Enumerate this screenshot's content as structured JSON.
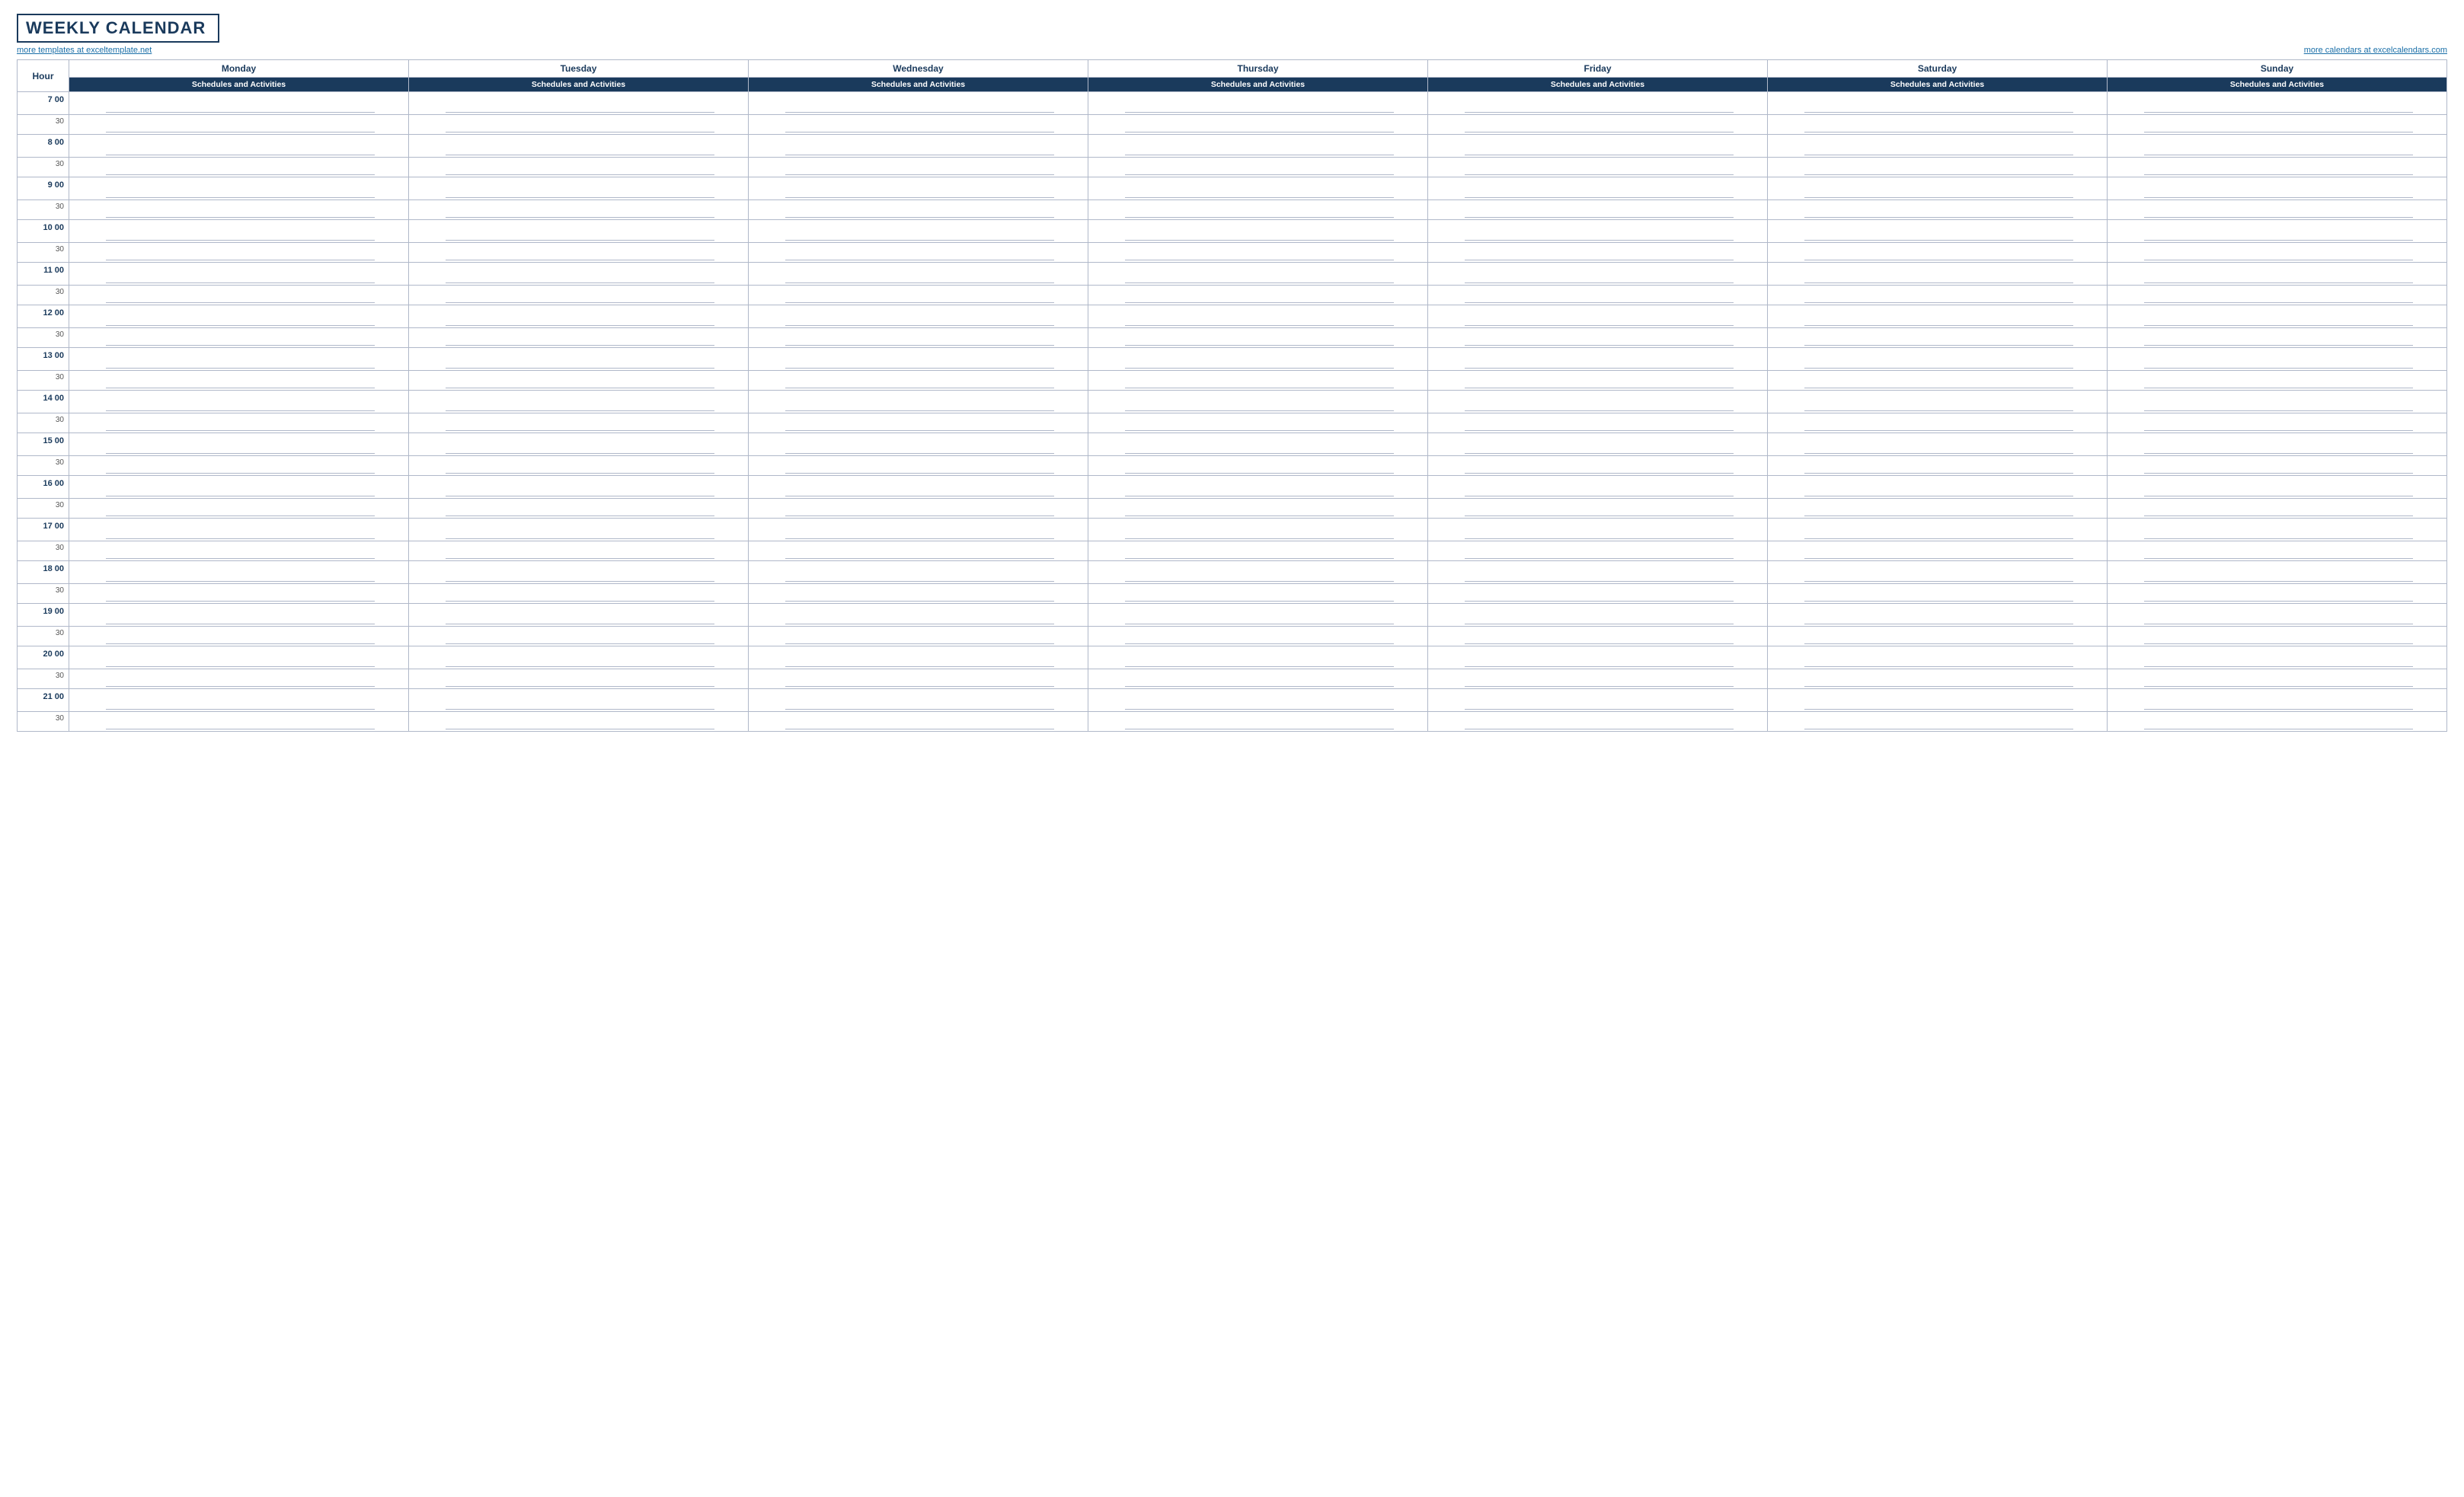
{
  "title": "WEEKLY CALENDAR",
  "links": {
    "left": "more templates at exceltemplate.net",
    "right": "more calendars at excelcalendars.com"
  },
  "header": {
    "hour_label": "Hour",
    "days": [
      "Monday",
      "Tuesday",
      "Wednesday",
      "Thursday",
      "Friday",
      "Saturday",
      "Sunday"
    ],
    "sub_label": "Schedules and Activities"
  },
  "hours": [
    {
      "label": "7  00",
      "half": "30"
    },
    {
      "label": "8  00",
      "half": "30"
    },
    {
      "label": "9  00",
      "half": "30"
    },
    {
      "label": "10  00",
      "half": "30"
    },
    {
      "label": "11  00",
      "half": "30"
    },
    {
      "label": "12  00",
      "half": "30"
    },
    {
      "label": "13  00",
      "half": "30"
    },
    {
      "label": "14  00",
      "half": "30"
    },
    {
      "label": "15  00",
      "half": "30"
    },
    {
      "label": "16  00",
      "half": "30"
    },
    {
      "label": "17  00",
      "half": "30"
    },
    {
      "label": "18  00",
      "half": "30"
    },
    {
      "label": "19  00",
      "half": "30"
    },
    {
      "label": "20  00",
      "half": "30"
    },
    {
      "label": "21  00",
      "half": "30"
    }
  ]
}
